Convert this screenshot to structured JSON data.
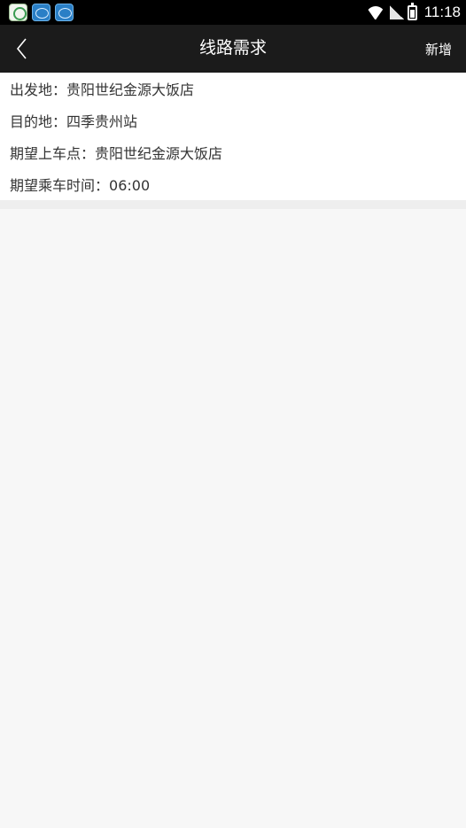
{
  "status_bar": {
    "time": "11:18",
    "app_icons": [
      "green-circle-app-icon",
      "blue-car-app-icon",
      "blue-car-app-icon"
    ],
    "indicators": [
      "wifi-icon",
      "signal-icon",
      "battery-icon"
    ]
  },
  "app_bar": {
    "title": "线路需求",
    "back_icon": "chevron-left-icon",
    "action_label": "新增",
    "background": "#1b1b1b"
  },
  "route": {
    "fields": [
      {
        "label": "出发地",
        "separator": "：",
        "value": "贵阳世纪金源大饭店"
      },
      {
        "label": "目的地",
        "separator": "：",
        "value": "四季贵州站"
      },
      {
        "label": "期望上车点",
        "separator": "：",
        "value": "贵阳世纪金源大饭店"
      },
      {
        "label": "期望乘车时间",
        "separator": "：",
        "value": "06:00"
      }
    ]
  }
}
